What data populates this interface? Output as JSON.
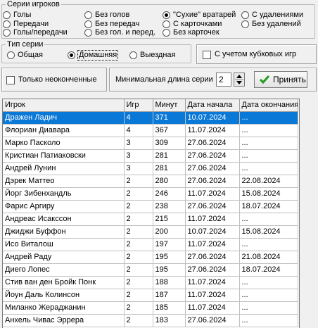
{
  "series_group": {
    "legend": "Серии игроков",
    "options": [
      {
        "label": "Голы",
        "selected": false
      },
      {
        "label": "Без голов",
        "selected": false
      },
      {
        "label": "\"Сухие\" вратарей",
        "selected": true
      },
      {
        "label": "С удалениями",
        "selected": false
      },
      {
        "label": "Передачи",
        "selected": false
      },
      {
        "label": "Без передач",
        "selected": false
      },
      {
        "label": "С карточками",
        "selected": false
      },
      {
        "label": "Без удалений",
        "selected": false
      },
      {
        "label": "Голы/передачи",
        "selected": false
      },
      {
        "label": "Без гол. и перед.",
        "selected": false
      },
      {
        "label": "Без карточек",
        "selected": false
      }
    ]
  },
  "type_group": {
    "legend": "Тип серии",
    "options": [
      {
        "label": "Общая",
        "selected": false
      },
      {
        "label": "Домашняя",
        "selected": true
      },
      {
        "label": "Выездная",
        "selected": false
      }
    ]
  },
  "cup_games_label": "С учетом кубковых игр",
  "unfinished_label": "Только неоконченные",
  "min_length_label": "Минимальная длина серии",
  "min_length_value": "2",
  "accept_label": "Принять",
  "table": {
    "columns": [
      "Игрок",
      "Игр",
      "Минут",
      "Дата начала",
      "Дата окончания"
    ],
    "rows": [
      [
        "Дражен Ладич",
        "4",
        "371",
        "10.07.2024",
        "..."
      ],
      [
        "Флориан Диавара",
        "4",
        "367",
        "11.07.2024",
        "..."
      ],
      [
        "Марко Пасколо",
        "3",
        "309",
        "27.06.2024",
        "..."
      ],
      [
        "Кристиан Патиаковски",
        "3",
        "281",
        "27.06.2024",
        "..."
      ],
      [
        "Андрей Лунин",
        "3",
        "281",
        "27.06.2024",
        "..."
      ],
      [
        "Дэрек Маттео",
        "2",
        "280",
        "27.06.2024",
        "22.08.2024"
      ],
      [
        "Йорг Зибенхандль",
        "2",
        "246",
        "11.07.2024",
        "15.08.2024"
      ],
      [
        "Фарис Аргиру",
        "2",
        "238",
        "27.06.2024",
        "18.07.2024"
      ],
      [
        "Андреас Исакссон",
        "2",
        "215",
        "11.07.2024",
        "..."
      ],
      [
        "Джиджи Буффон",
        "2",
        "200",
        "10.07.2024",
        "15.08.2024"
      ],
      [
        "Исо Виталош",
        "2",
        "197",
        "11.07.2024",
        "..."
      ],
      [
        "Андрей Раду",
        "2",
        "195",
        "27.06.2024",
        "21.08.2024"
      ],
      [
        "Диего Лопес",
        "2",
        "195",
        "27.06.2024",
        "18.07.2024"
      ],
      [
        "Стив ван ден Бройк Понк",
        "2",
        "188",
        "11.07.2024",
        "..."
      ],
      [
        "Йоун Даль Колинсон",
        "2",
        "187",
        "11.07.2024",
        "..."
      ],
      [
        "Миланко Жераджанин",
        "2",
        "185",
        "11.07.2024",
        "..."
      ],
      [
        "Анхель Чивас Эррера",
        "2",
        "183",
        "27.06.2024",
        "..."
      ]
    ],
    "selected_row": 0
  },
  "colors": {
    "selection": "#0a78d7",
    "accept_check": "#1e9e1e"
  }
}
